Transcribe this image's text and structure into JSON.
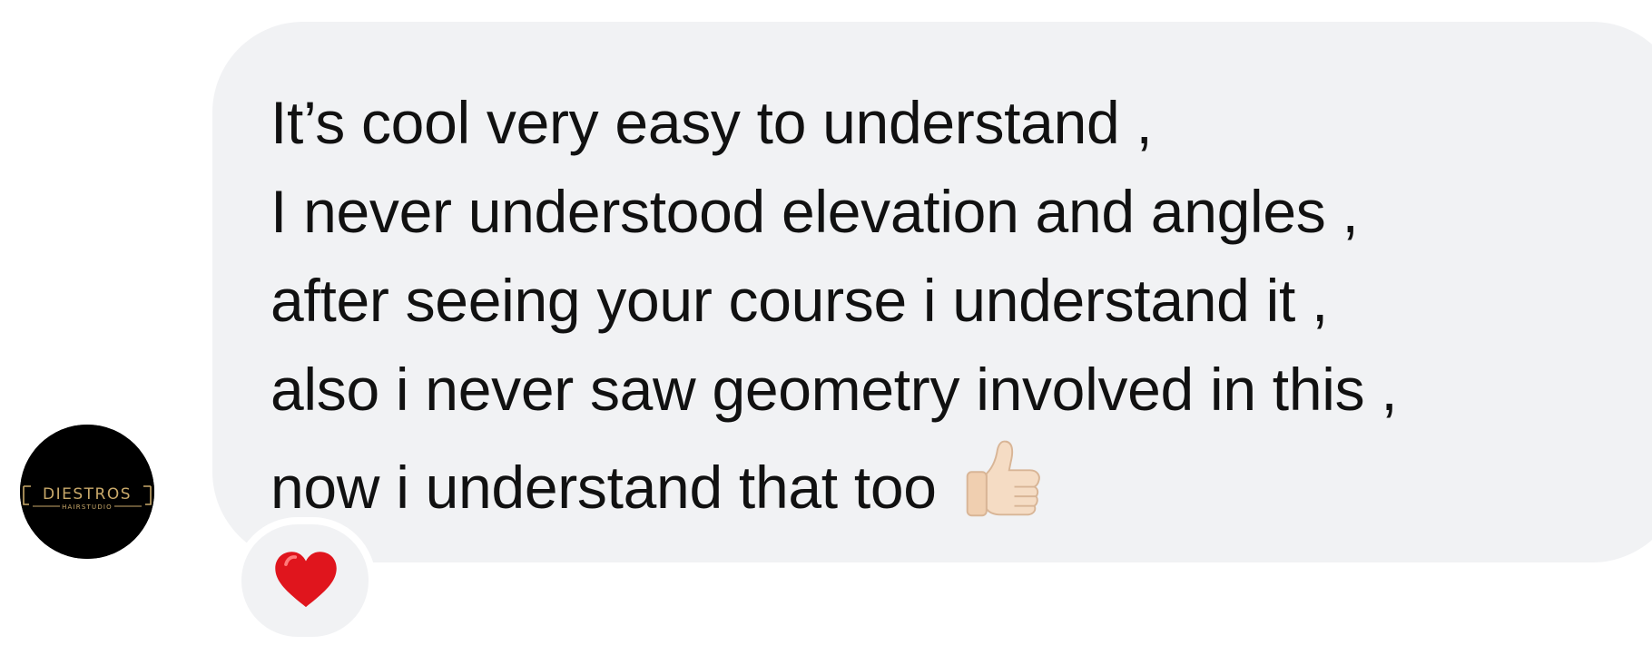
{
  "avatar": {
    "brand_text": "DIESTROS",
    "sub_text": "HAIRSTUDIO",
    "background": "#000000",
    "accent": "#c9a96a"
  },
  "message": {
    "lines": [
      "It’s cool very easy to understand ,",
      "I never understood elevation and angles ,",
      "after seeing your course i understand it ,",
      "also i never saw geometry involved in this ,",
      "now i understand that too"
    ],
    "trailing_emoji": "thumbs-up-icon",
    "bubble_color": "#f1f2f4",
    "text_color": "#111111"
  },
  "reaction": {
    "emoji": "red-heart-icon",
    "color": "#e0151d"
  }
}
